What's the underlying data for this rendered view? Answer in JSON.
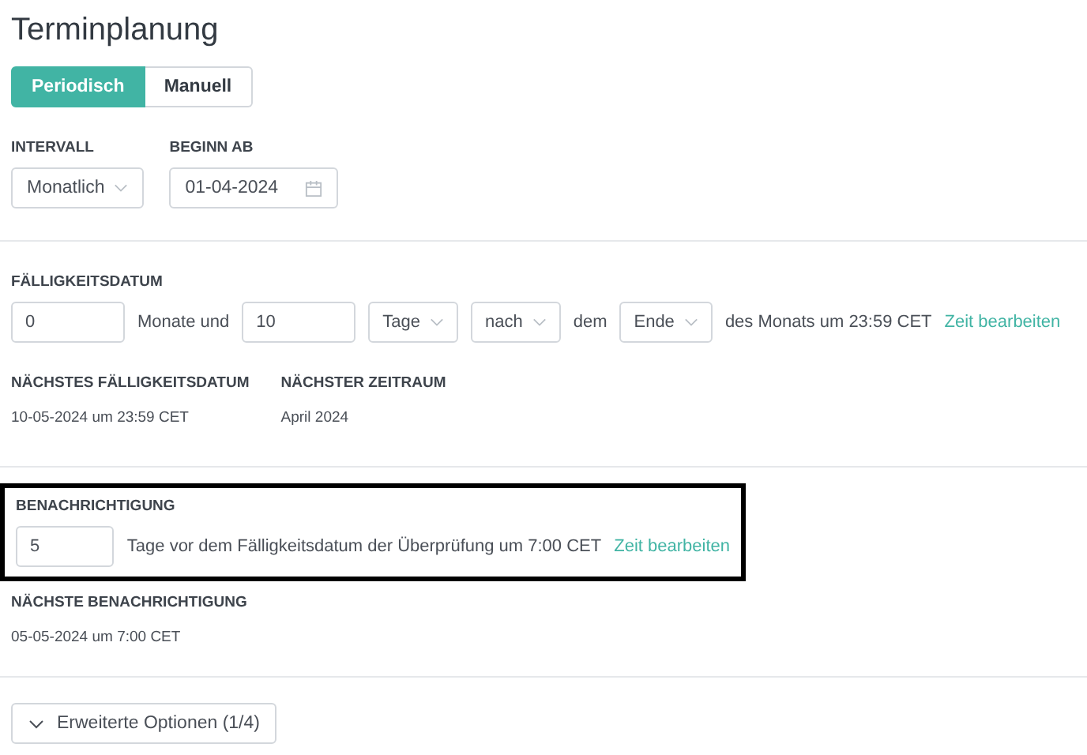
{
  "title": "Terminplanung",
  "mode_tabs": [
    {
      "label": "Periodisch",
      "selected": true
    },
    {
      "label": "Manuell",
      "selected": false
    }
  ],
  "schedule": {
    "fields": [
      {
        "label": "INTERVALL",
        "kind": "select",
        "value": "Monatlich"
      },
      {
        "label": "BEGINN AB",
        "kind": "date",
        "value": "01-04-2024"
      }
    ]
  },
  "due_date": {
    "label": "FÄLLIGKEITSDATUM",
    "parts": [
      {
        "kind": "input",
        "value": "0"
      },
      {
        "kind": "text",
        "text": "Monate und"
      },
      {
        "kind": "input",
        "value": "10"
      },
      {
        "kind": "select",
        "value": "Tage"
      },
      {
        "kind": "select",
        "value": "nach"
      },
      {
        "kind": "text",
        "text": "dem"
      },
      {
        "kind": "select",
        "value": "Ende"
      },
      {
        "kind": "text",
        "text": "des Monats um 23:59 CET"
      },
      {
        "kind": "link",
        "text": "Zeit bearbeiten"
      }
    ],
    "info": [
      {
        "label": "NÄCHSTES FÄLLIGKEITSDATUM",
        "value": "10-05-2024 um 23:59 CET"
      },
      {
        "label": "NÄCHSTER ZEITRAUM",
        "value": "April 2024"
      }
    ]
  },
  "notification": {
    "label": "BENACHRICHTIGUNG",
    "highlighted": true,
    "parts": [
      {
        "kind": "input",
        "value": "5"
      },
      {
        "kind": "text",
        "text": "Tage vor dem Fälligkeitsdatum der Überprüfung um 7:00 CET"
      },
      {
        "kind": "link",
        "text": "Zeit bearbeiten"
      }
    ],
    "info": [
      {
        "label": "NÄCHSTE BENACHRICHTIGUNG",
        "value": "05-05-2024 um 7:00 CET"
      }
    ]
  },
  "advanced_button": {
    "label": "Erweiterte Optionen (1/4)",
    "expanded": false
  }
}
